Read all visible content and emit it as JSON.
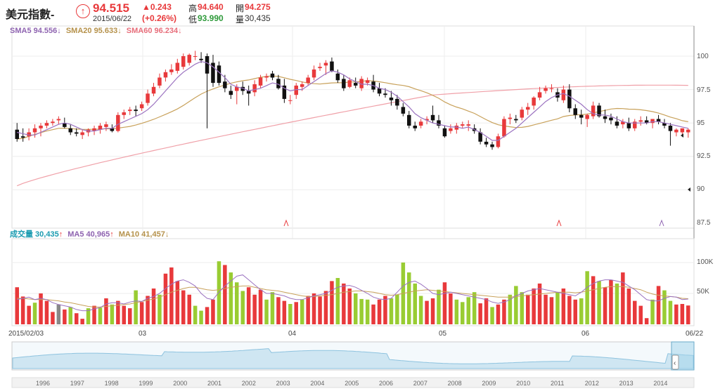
{
  "quote": {
    "name": "美元指數-",
    "price": "94.515",
    "change": "▲0.243",
    "change_pct": "(+0.26%)",
    "date": "2015/06/22",
    "high_label": "高",
    "high": "94.640",
    "open_label": "開",
    "open": "94.275",
    "low_label": "低",
    "low": "93.990",
    "vol_label": "量",
    "volume": "30,435"
  },
  "price_legend": [
    {
      "label": "SMA5 94.556",
      "arrow": "↓",
      "color": "#8e63b0"
    },
    {
      "label": "SMA20 95.633",
      "arrow": "↓",
      "color": "#b5914a"
    },
    {
      "label": "SMA60 96.234",
      "arrow": "↓",
      "color": "#e76d7a"
    }
  ],
  "volume_legend": [
    {
      "label": "成交量 30,435",
      "arrow": "↑",
      "color": "#1a9bb0"
    },
    {
      "label": "MA5 40,965",
      "arrow": "↑",
      "color": "#8e63b0"
    },
    {
      "label": "MA10 41,457",
      "arrow": "↓",
      "color": "#b5914a"
    }
  ],
  "colors": {
    "up": "#e8393b",
    "down": "#111111",
    "vol_up": "#e8393b",
    "vol_down": "#99cc33",
    "accent": "#e8393b"
  },
  "price_axis": {
    "ticks": [
      "100",
      "97.5",
      "95",
      "92.5",
      "90",
      "87.5"
    ]
  },
  "volume_axis": {
    "ticks": [
      "100K",
      "50K"
    ]
  },
  "x_axis": {
    "labels": [
      "2015/02/03",
      "03",
      "04",
      "05",
      "06",
      "06/22"
    ]
  },
  "navigator": {
    "years": [
      "1996",
      "1997",
      "1998",
      "1999",
      "2000",
      "2001",
      "2002",
      "2003",
      "2004",
      "2005",
      "2006",
      "2007",
      "2008",
      "2009",
      "2010",
      "2011",
      "2012",
      "2013",
      "2014"
    ]
  },
  "chart_data": {
    "type": "candlestick",
    "ylim": [
      87,
      101.5
    ],
    "candles": [
      [
        94.5,
        95.0,
        93.6,
        93.8
      ],
      [
        94.0,
        94.6,
        93.6,
        93.9
      ],
      [
        94.0,
        94.6,
        93.7,
        94.3
      ],
      [
        94.3,
        94.9,
        93.9,
        94.6
      ],
      [
        94.6,
        95.0,
        94.0,
        94.8
      ],
      [
        94.8,
        95.2,
        94.6,
        95.0
      ],
      [
        95.0,
        95.3,
        94.8,
        95.1
      ],
      [
        95.2,
        95.5,
        94.9,
        95.3
      ],
      [
        95.0,
        95.4,
        94.6,
        94.7
      ],
      [
        94.6,
        94.9,
        94.1,
        94.3
      ],
      [
        94.3,
        94.6,
        94.0,
        94.2
      ],
      [
        94.1,
        94.5,
        93.8,
        94.3
      ],
      [
        94.3,
        94.6,
        94.0,
        94.5
      ],
      [
        94.4,
        94.8,
        94.1,
        94.6
      ],
      [
        94.5,
        95.0,
        94.2,
        94.8
      ],
      [
        94.7,
        95.1,
        94.4,
        94.9
      ],
      [
        94.6,
        94.9,
        94.3,
        94.4
      ],
      [
        94.4,
        95.8,
        94.3,
        95.6
      ],
      [
        95.6,
        96.0,
        95.3,
        95.8
      ],
      [
        95.9,
        96.2,
        95.6,
        96.0
      ],
      [
        96.0,
        96.3,
        95.5,
        95.9
      ],
      [
        96.1,
        96.6,
        95.9,
        96.4
      ],
      [
        96.5,
        97.5,
        96.3,
        97.2
      ],
      [
        97.2,
        98.0,
        97.0,
        97.7
      ],
      [
        97.8,
        98.7,
        97.6,
        98.4
      ],
      [
        98.4,
        99.0,
        98.1,
        98.8
      ],
      [
        98.8,
        99.4,
        98.6,
        99.0
      ],
      [
        98.9,
        99.8,
        98.7,
        99.5
      ],
      [
        99.2,
        100.2,
        99.0,
        100.0
      ],
      [
        99.5,
        100.2,
        99.3,
        100.1
      ],
      [
        100.0,
        100.4,
        99.7,
        100.0
      ],
      [
        99.8,
        100.3,
        99.5,
        99.7
      ],
      [
        100.0,
        100.2,
        94.6,
        98.7
      ],
      [
        99.5,
        100.1,
        97.7,
        98.0
      ],
      [
        99.3,
        99.6,
        97.8,
        98.0
      ],
      [
        98.1,
        98.6,
        97.3,
        97.6
      ],
      [
        97.4,
        97.8,
        96.8,
        97.1
      ],
      [
        97.4,
        97.9,
        96.4,
        97.7
      ],
      [
        97.7,
        98.1,
        97.1,
        97.4
      ],
      [
        97.4,
        97.8,
        96.3,
        97.2
      ],
      [
        97.3,
        98.2,
        97.0,
        97.9
      ],
      [
        97.8,
        98.6,
        97.6,
        98.4
      ],
      [
        98.4,
        98.7,
        98.1,
        98.5
      ],
      [
        98.7,
        98.9,
        98.2,
        98.4
      ],
      [
        98.3,
        98.6,
        97.5,
        97.6
      ],
      [
        97.8,
        98.3,
        96.5,
        96.8
      ],
      [
        96.7,
        97.1,
        96.4,
        96.7
      ],
      [
        97.1,
        98.0,
        96.8,
        97.8
      ],
      [
        97.7,
        98.1,
        97.4,
        97.9
      ],
      [
        98.0,
        98.6,
        97.8,
        98.4
      ],
      [
        98.4,
        99.3,
        98.2,
        99.0
      ],
      [
        99.1,
        99.5,
        98.9,
        99.2
      ],
      [
        99.3,
        99.7,
        98.6,
        99.5
      ],
      [
        99.6,
        99.9,
        98.8,
        98.9
      ],
      [
        98.7,
        99.0,
        98.0,
        98.2
      ],
      [
        98.3,
        98.6,
        97.4,
        97.6
      ],
      [
        97.7,
        98.4,
        97.6,
        98.2
      ],
      [
        98.0,
        98.4,
        97.6,
        97.8
      ],
      [
        97.6,
        98.5,
        97.4,
        98.3
      ],
      [
        98.0,
        98.4,
        97.8,
        98.2
      ],
      [
        98.1,
        98.6,
        97.3,
        97.5
      ],
      [
        97.6,
        98.0,
        97.0,
        97.2
      ],
      [
        97.2,
        97.6,
        96.9,
        97.1
      ],
      [
        96.9,
        97.4,
        96.3,
        96.7
      ],
      [
        96.8,
        97.1,
        96.0,
        96.3
      ],
      [
        96.2,
        96.5,
        95.5,
        95.7
      ],
      [
        95.6,
        95.9,
        94.6,
        94.8
      ],
      [
        94.8,
        95.1,
        94.4,
        94.6
      ],
      [
        94.8,
        95.3,
        94.6,
        95.1
      ],
      [
        95.2,
        95.5,
        94.9,
        95.3
      ],
      [
        95.6,
        96.3,
        95.0,
        95.2
      ],
      [
        95.2,
        95.6,
        94.6,
        94.8
      ],
      [
        94.6,
        94.8,
        93.9,
        94.0
      ],
      [
        94.4,
        94.9,
        94.2,
        94.6
      ],
      [
        94.5,
        95.0,
        94.2,
        94.8
      ],
      [
        94.8,
        95.1,
        94.6,
        94.9
      ],
      [
        94.8,
        95.2,
        94.4,
        94.9
      ],
      [
        94.6,
        94.9,
        94.2,
        94.4
      ],
      [
        94.3,
        94.6,
        93.4,
        93.6
      ],
      [
        93.6,
        93.9,
        93.2,
        93.4
      ],
      [
        93.4,
        93.6,
        93.0,
        93.2
      ],
      [
        93.2,
        94.2,
        93.1,
        94.0
      ],
      [
        94.0,
        95.5,
        93.9,
        95.3
      ],
      [
        95.3,
        95.7,
        94.9,
        95.4
      ],
      [
        95.3,
        95.6,
        95.0,
        95.2
      ],
      [
        95.4,
        96.2,
        95.2,
        96.0
      ],
      [
        96.0,
        96.5,
        95.6,
        96.2
      ],
      [
        96.3,
        97.0,
        96.0,
        96.9
      ],
      [
        96.9,
        97.7,
        96.7,
        97.3
      ],
      [
        97.4,
        97.8,
        97.2,
        97.6
      ],
      [
        97.6,
        97.9,
        97.3,
        97.6
      ],
      [
        97.3,
        97.6,
        96.6,
        96.9
      ],
      [
        96.7,
        97.8,
        96.5,
        97.5
      ],
      [
        97.5,
        97.9,
        95.8,
        96.1
      ],
      [
        96.1,
        96.4,
        95.3,
        95.6
      ],
      [
        95.6,
        96.0,
        94.9,
        95.4
      ],
      [
        95.3,
        95.7,
        94.7,
        95.6
      ],
      [
        95.5,
        96.6,
        95.3,
        96.3
      ],
      [
        96.3,
        96.5,
        95.4,
        95.5
      ],
      [
        95.5,
        96.0,
        95.0,
        95.3
      ],
      [
        95.4,
        95.7,
        94.9,
        95.2
      ],
      [
        95.1,
        95.5,
        94.6,
        94.8
      ],
      [
        94.9,
        95.3,
        94.6,
        95.1
      ],
      [
        95.0,
        95.4,
        94.4,
        94.6
      ],
      [
        94.6,
        95.3,
        94.4,
        95.1
      ],
      [
        95.1,
        95.5,
        94.8,
        95.2
      ],
      [
        95.2,
        95.5,
        94.9,
        95.0
      ],
      [
        95.0,
        95.3,
        94.6,
        95.3
      ],
      [
        95.3,
        95.6,
        94.9,
        95.1
      ],
      [
        95.0,
        95.3,
        94.6,
        94.8
      ],
      [
        94.8,
        95.0,
        93.3,
        94.4
      ],
      [
        94.3,
        94.6,
        94.0,
        94.5
      ],
      [
        94.3,
        94.6,
        94.0,
        94.6
      ],
      [
        94.3,
        94.6,
        93.9,
        94.5
      ]
    ],
    "sma5": [
      94.3,
      94.2,
      94.1,
      94.1,
      94.3,
      94.5,
      94.7,
      94.9,
      95.0,
      94.9,
      94.7,
      94.5,
      94.4,
      94.4,
      94.5,
      94.6,
      94.6,
      94.9,
      95.1,
      95.3,
      95.5,
      95.7,
      96.0,
      96.4,
      96.9,
      97.4,
      97.9,
      98.4,
      98.8,
      99.1,
      99.4,
      99.6,
      99.5,
      99.2,
      98.8,
      98.4,
      97.9,
      97.7,
      97.6,
      97.4,
      97.5,
      97.6,
      97.8,
      98.0,
      97.9,
      97.6,
      97.4,
      97.5,
      97.5,
      97.8,
      98.1,
      98.4,
      98.7,
      98.9,
      98.8,
      98.6,
      98.3,
      98.1,
      97.9,
      97.9,
      97.8,
      97.6,
      97.5,
      97.3,
      97.0,
      96.6,
      96.2,
      95.7,
      95.4,
      95.2,
      95.0,
      94.9,
      94.8,
      94.7,
      94.7,
      94.6,
      94.7,
      94.5,
      94.3,
      94.0,
      93.7,
      93.7,
      94.0,
      94.3,
      94.6,
      95.0,
      95.4,
      95.8,
      96.2,
      96.6,
      96.9,
      97.1,
      97.2,
      97.0,
      96.7,
      96.4,
      96.0,
      95.7,
      95.6,
      95.6,
      95.5,
      95.3,
      95.1,
      95.0,
      95.0,
      95.0,
      95.0,
      95.1,
      95.1,
      95.0,
      94.9,
      94.8,
      94.7,
      94.6
    ]
  },
  "volume_data": {
    "ylim": [
      0,
      120000
    ],
    "values": [
      60000,
      45000,
      30000,
      35000,
      50000,
      38000,
      20000,
      32000,
      24000,
      28000,
      18000,
      9000,
      26000,
      30000,
      27000,
      42000,
      32000,
      38000,
      30000,
      26000,
      55000,
      36000,
      46000,
      58000,
      48000,
      82000,
      92000,
      70000,
      55000,
      48000,
      30000,
      22000,
      28000,
      40000,
      102000,
      96000,
      84000,
      68000,
      54000,
      60000,
      48000,
      56000,
      40000,
      52000,
      44000,
      38000,
      33000,
      36000,
      40000,
      46000,
      50000,
      45000,
      54000,
      70000,
      75000,
      66000,
      58000,
      50000,
      41000,
      40000,
      32000,
      40000,
      46000,
      42000,
      48000,
      100000,
      84000,
      66000,
      46000,
      38000,
      42000,
      56000,
      68000,
      50000,
      40000,
      36000,
      44000,
      52000,
      34000,
      42000,
      28000,
      32000,
      40000,
      48000,
      62000,
      52000,
      48000,
      58000,
      66000,
      48000,
      44000,
      52000,
      58000,
      46000,
      40000,
      42000,
      86000,
      78000,
      70000,
      60000,
      72000,
      66000,
      84000,
      58000,
      38000,
      30000,
      10000,
      40000,
      62000,
      55000,
      38000,
      32000,
      33000,
      30435
    ],
    "colors": [
      "up",
      "up",
      "up",
      "down",
      "up",
      "up",
      "up",
      "neutral",
      "up",
      "down",
      "up",
      "up",
      "down",
      "up",
      "down",
      "up",
      "down",
      "up",
      "up",
      "up",
      "down",
      "up",
      "up",
      "up",
      "down",
      "up",
      "up",
      "up",
      "up",
      "up",
      "down",
      "down",
      "up",
      "up",
      "down",
      "up",
      "down",
      "down",
      "down",
      "up",
      "up",
      "up",
      "down",
      "down",
      "up",
      "up",
      "down",
      "up",
      "down",
      "up",
      "up",
      "up",
      "up",
      "up",
      "down",
      "up",
      "up",
      "down",
      "down",
      "down",
      "up",
      "up",
      "up",
      "down",
      "down",
      "down",
      "down",
      "down",
      "down",
      "up",
      "up",
      "down",
      "up",
      "up",
      "down",
      "down",
      "down",
      "down",
      "up",
      "up",
      "down",
      "up",
      "up",
      "down",
      "down",
      "down",
      "up",
      "up",
      "up",
      "up",
      "up",
      "down",
      "up",
      "up",
      "up",
      "down",
      "down",
      "up",
      "down",
      "up",
      "up",
      "down",
      "up",
      "up",
      "up",
      "up",
      "up",
      "down",
      "up",
      "down",
      "down",
      "up",
      "up",
      "up"
    ],
    "ma5": [
      40000,
      42000,
      44000,
      40000,
      42000,
      40000,
      35000,
      32000,
      30000,
      28000,
      24000,
      22000,
      22000,
      25000,
      27000,
      33000,
      35000,
      35000,
      33000,
      36000,
      38000,
      37000,
      42000,
      45000,
      50000,
      58000,
      65000,
      70000,
      72000,
      68000,
      62000,
      50000,
      42000,
      40000,
      52000,
      62000,
      70000,
      78000,
      80000,
      72000,
      64000,
      56000,
      50000,
      50000,
      48000,
      46000,
      42000,
      40000,
      40000,
      43000,
      46000,
      48000,
      50000,
      55000,
      60000,
      62000,
      63000,
      60000,
      55000,
      50000,
      44000,
      41000,
      40000,
      42000,
      52000,
      62000,
      68000,
      70000,
      65000,
      58000,
      50000,
      48000,
      50000,
      52000,
      50000,
      48000,
      46000,
      44000,
      42000,
      40000,
      36000,
      34000,
      36000,
      40000,
      46000,
      50000,
      54000,
      56000,
      58000,
      56000,
      54000,
      52000,
      50000,
      48000,
      46000,
      52000,
      60000,
      66000,
      70000,
      72000,
      72000,
      70000,
      68000,
      62000,
      56000,
      48000,
      40000,
      38000,
      38000,
      42000,
      45000,
      44000,
      40000,
      40965
    ],
    "ma10": [
      42000,
      42000,
      41000,
      40000,
      40000,
      40000,
      39000,
      38000,
      36000,
      35000,
      33000,
      31000,
      29000,
      28000,
      28000,
      29000,
      30000,
      31000,
      32000,
      33000,
      35000,
      37000,
      39000,
      41000,
      44000,
      48000,
      52000,
      55000,
      58000,
      60000,
      60000,
      58000,
      56000,
      55000,
      56000,
      58000,
      60000,
      61000,
      62000,
      62000,
      60000,
      58000,
      56000,
      55000,
      54000,
      52000,
      50000,
      48000,
      46000,
      45000,
      45000,
      46000,
      47000,
      48000,
      50000,
      52000,
      53000,
      54000,
      54000,
      53000,
      52000,
      50000,
      48000,
      47000,
      48000,
      50000,
      52000,
      54000,
      55000,
      56000,
      55000,
      54000,
      53000,
      52000,
      51000,
      50000,
      49000,
      48000,
      47000,
      46000,
      45000,
      44000,
      44000,
      44000,
      45000,
      46000,
      47000,
      48000,
      49000,
      50000,
      51000,
      52000,
      52000,
      52000,
      51000,
      52000,
      54000,
      56000,
      58000,
      60000,
      61000,
      61000,
      61000,
      60000,
      58000,
      56000,
      52000,
      49000,
      47000,
      46000,
      45000,
      44000,
      42000,
      41457
    ]
  }
}
